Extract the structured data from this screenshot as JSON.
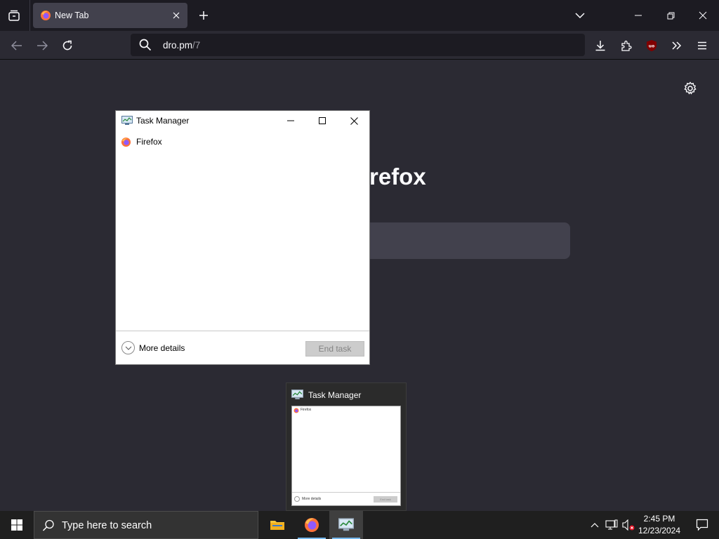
{
  "browser": {
    "tab": {
      "title": "New Tab"
    },
    "url": {
      "host": "dro.pm",
      "path": "/7"
    },
    "content": {
      "heading": "refox"
    }
  },
  "task_manager": {
    "title": "Task Manager",
    "apps": [
      {
        "name": "Firefox"
      }
    ],
    "more_details": "More details",
    "end_task": "End task"
  },
  "thumbnail": {
    "title": "Task Manager",
    "app": "Firefox",
    "more_details": "More details",
    "end_task": "End task"
  },
  "taskbar": {
    "search_placeholder": "Type here to search",
    "time": "2:45 PM",
    "date": "12/23/2024"
  },
  "colors": {
    "browser_bg": "#2b2a33",
    "taskbar_bg": "#1f1f1f",
    "accent": "#76b9ed"
  }
}
